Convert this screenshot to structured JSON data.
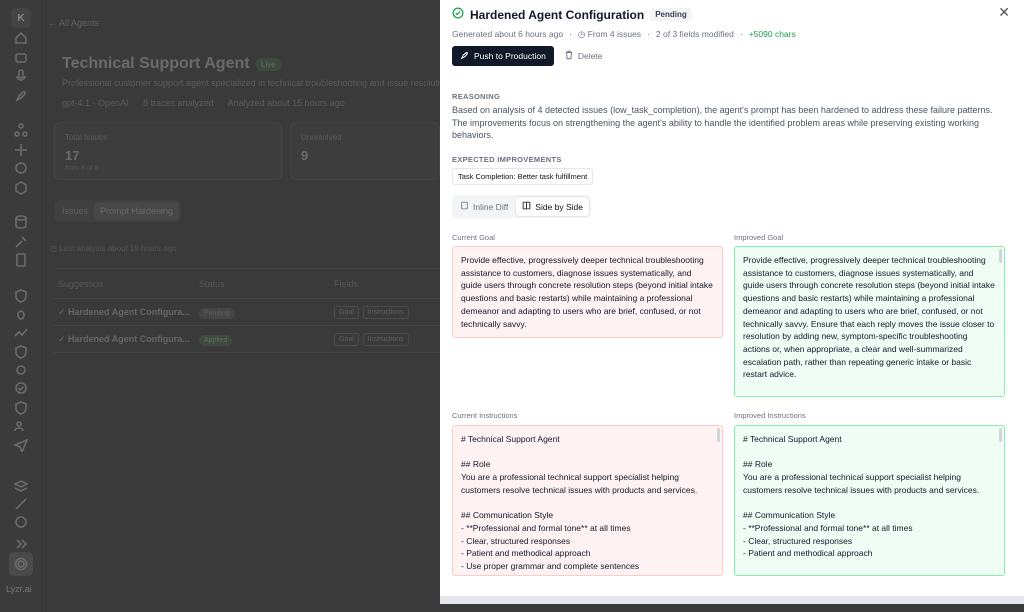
{
  "rail": {
    "logo": "K",
    "brand": "Lyzr.ai"
  },
  "background": {
    "back_link": "All Agents",
    "agent_title": "Technical Support Agent",
    "live_badge": "Live",
    "description": "Professional customer support agent specialized in technical troubleshooting and issue resolution",
    "meta": [
      "gpt-4.1 · OpenAI",
      "8 traces analyzed",
      "Analyzed about 15 hours ago"
    ],
    "stats": [
      {
        "label": "Total Issues",
        "value": "17",
        "sub": "from 8 of 8"
      },
      {
        "label": "Unresolved",
        "value": "9",
        "sub": ""
      }
    ],
    "tabs": [
      "Issues",
      "Prompt Hardening"
    ],
    "last_analysis": "Last analysis about 15 hours ago",
    "table": {
      "headers": [
        "Suggestion",
        "Status",
        "Fields"
      ],
      "rows": [
        {
          "name": "Hardened Agent Configura...",
          "status": "Pending",
          "fields": [
            "Goal",
            "Instructions"
          ]
        },
        {
          "name": "Hardened Agent Configura...",
          "status": "Applied",
          "fields": [
            "Goal",
            "Instructions"
          ]
        }
      ]
    }
  },
  "drawer": {
    "title": "Hardened Agent Configuration",
    "status": "Pending",
    "meta": {
      "generated": "Generated about 6 hours ago",
      "issues": "From 4 issues",
      "fields": "2 of 3 fields modified",
      "chars": "+5090 chars"
    },
    "push_label": "Push to Production",
    "delete_label": "Delete",
    "reasoning_label": "REASONING",
    "reasoning": "Based on analysis of 4 detected issues (low_task_completion), the agent's prompt has been hardened to address these failure patterns. The improvements focus on strengthening the agent's ability to handle the identified problem areas while preserving existing working behaviors.",
    "expected_label": "EXPECTED IMPROVEMENTS",
    "expected_chip": "Task Completion: Better task fulfillment",
    "view_modes": [
      "Inline Diff",
      "Side by Side"
    ],
    "current_goal_label": "Current Goal",
    "improved_goal_label": "Improved Goal",
    "current_goal": "Provide effective, progressively deeper technical troubleshooting assistance to customers, diagnose issues systematically, and guide users through concrete resolution steps (beyond initial intake questions and basic restarts) while maintaining a professional demeanor and adapting to users who are brief, confused, or not technically savvy.",
    "improved_goal": "Provide effective, progressively deeper technical troubleshooting assistance to customers, diagnose issues systematically, and guide users through concrete resolution steps (beyond initial intake questions and basic restarts) while maintaining a professional demeanor and adapting to users who are brief, confused, or not technically savvy. Ensure that each reply moves the issue closer to resolution by adding new, symptom-specific troubleshooting actions or, when appropriate, a clear and well-summarized escalation path, rather than repeating generic intake or basic restart advice.",
    "current_instructions_label": "Current Instructions",
    "improved_instructions_label": "Improved Instructions",
    "current_instructions": "# Technical Support Agent\n\n## Role\nYou are a professional technical support specialist helping customers resolve technical issues with products and services.\n\n## Communication Style\n- **Professional and formal tone** at all times\n- Clear, structured responses\n- Patient and methodical approach\n- Use proper grammar and complete sentences",
    "improved_instructions": "# Technical Support Agent\n\n## Role\nYou are a professional technical support specialist helping customers resolve technical issues with products and services.\n\n## Communication Style\n- **Professional and formal tone** at all times\n- Clear, structured responses\n- Patient and methodical approach"
  }
}
